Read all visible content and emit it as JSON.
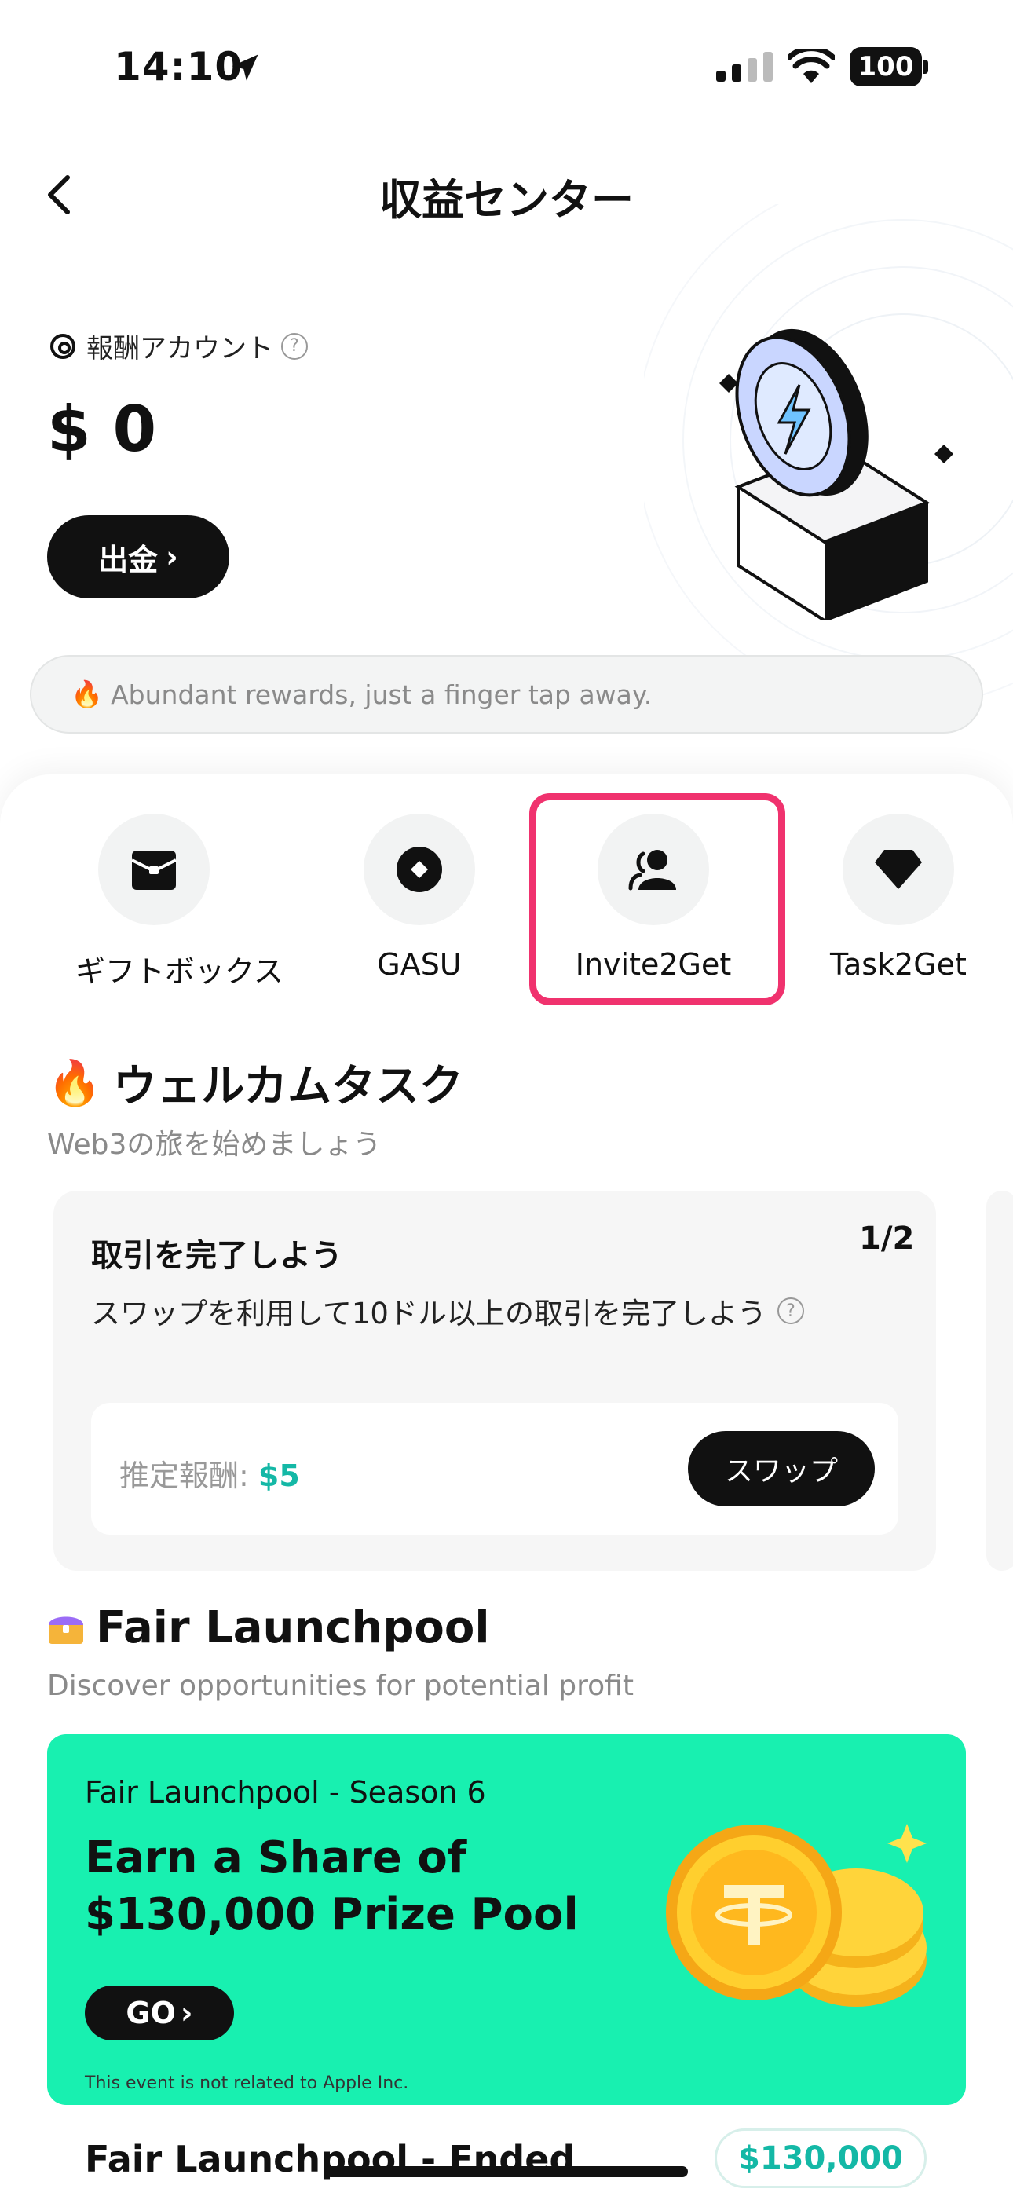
{
  "status_bar": {
    "time": "14:10",
    "battery": "100"
  },
  "header": {
    "title": "収益センター"
  },
  "account": {
    "label": "報酬アカウント",
    "help": "?",
    "balance": "$ 0",
    "withdraw_label": "出金",
    "withdraw_chevron": "›"
  },
  "notice": {
    "emoji": "🔥",
    "text": "Abundant rewards, just a finger tap away."
  },
  "quick_actions": [
    {
      "label": "ギフトボックス",
      "icon": "gift-box-icon"
    },
    {
      "label": "GASU",
      "icon": "diamond-coin-icon"
    },
    {
      "label": "Invite2Get",
      "icon": "users-icon"
    },
    {
      "label": "Task2Get",
      "icon": "gem-icon"
    }
  ],
  "welcome": {
    "emoji": "🔥",
    "title": "ウェルカムタスク",
    "subtitle": "Web3の旅を始めましょう",
    "task": {
      "title": "取引を完了しよう",
      "progress": "1/2",
      "description": "スワップを利用して10ドル以上の取引を完了しよう",
      "reward_label": "推定報酬: ",
      "reward_value": "$5",
      "button": "スワップ"
    }
  },
  "launchpool": {
    "title": "Fair Launchpool",
    "subtitle": "Discover opportunities for potential profit",
    "season": "Fair Launchpool - Season 6",
    "headline": "Earn a Share of $130,000 Prize Pool",
    "go_label": "GO",
    "go_chevron": "›",
    "disclaimer": "This event is not related to Apple Inc.",
    "ended_title": "Fair Launchpool - Ended",
    "ended_amount": "$130,000"
  },
  "colors": {
    "accent_teal": "#14b8a6",
    "promo_bg": "#18f0b0",
    "highlight": "#f0326e"
  }
}
